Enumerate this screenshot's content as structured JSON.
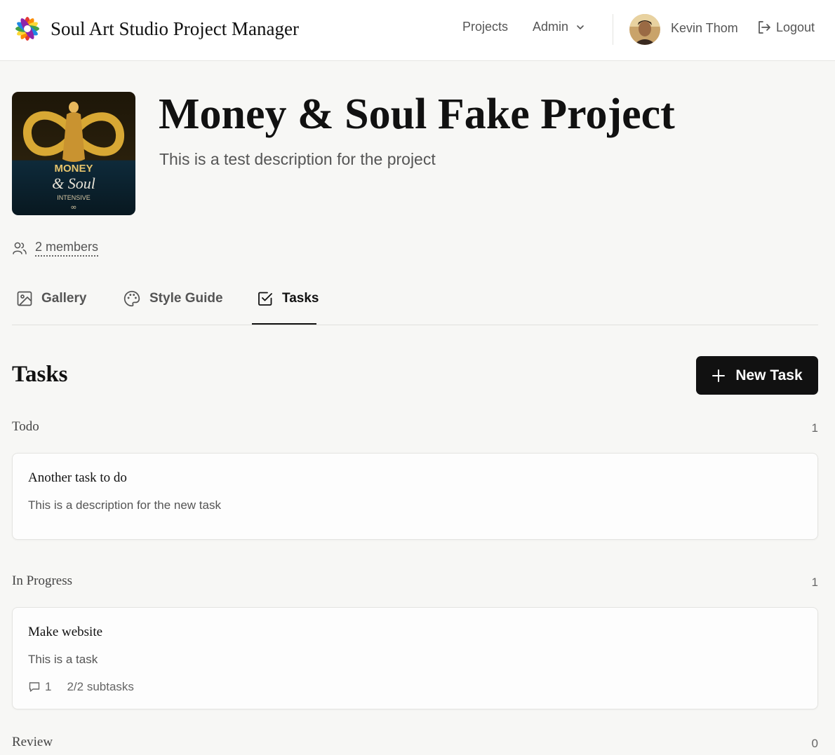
{
  "app": {
    "title": "Soul Art Studio Project Manager"
  },
  "nav": {
    "projects": "Projects",
    "admin": "Admin",
    "user_name": "Kevin Thom",
    "logout": "Logout"
  },
  "project": {
    "title": "Money & Soul Fake Project",
    "description": "This is a test description for the project",
    "members": "2 members",
    "cover_text": {
      "line1": "MONEY",
      "line2": "& Soul",
      "line3": "INTENSIVE",
      "mark": "∞"
    }
  },
  "tabs": [
    {
      "label": "Gallery",
      "icon": "image-icon"
    },
    {
      "label": "Style Guide",
      "icon": "palette-icon"
    },
    {
      "label": "Tasks",
      "icon": "checkbox-icon",
      "active": true
    }
  ],
  "tasks": {
    "heading": "Tasks",
    "new_task_label": "New Task",
    "groups": [
      {
        "label": "Todo",
        "count": "1",
        "items": [
          {
            "title": "Another task to do",
            "description": "This is a description for the new task"
          }
        ]
      },
      {
        "label": "In Progress",
        "count": "1",
        "items": [
          {
            "title": "Make website",
            "description": "This is a task",
            "comments": "1",
            "subtasks": "2/2 subtasks"
          }
        ]
      },
      {
        "label": "Review",
        "count": "0",
        "items": []
      }
    ]
  },
  "colors": {
    "accent": "#111111",
    "background": "#f7f7f5",
    "card": "#fdfdfd"
  }
}
